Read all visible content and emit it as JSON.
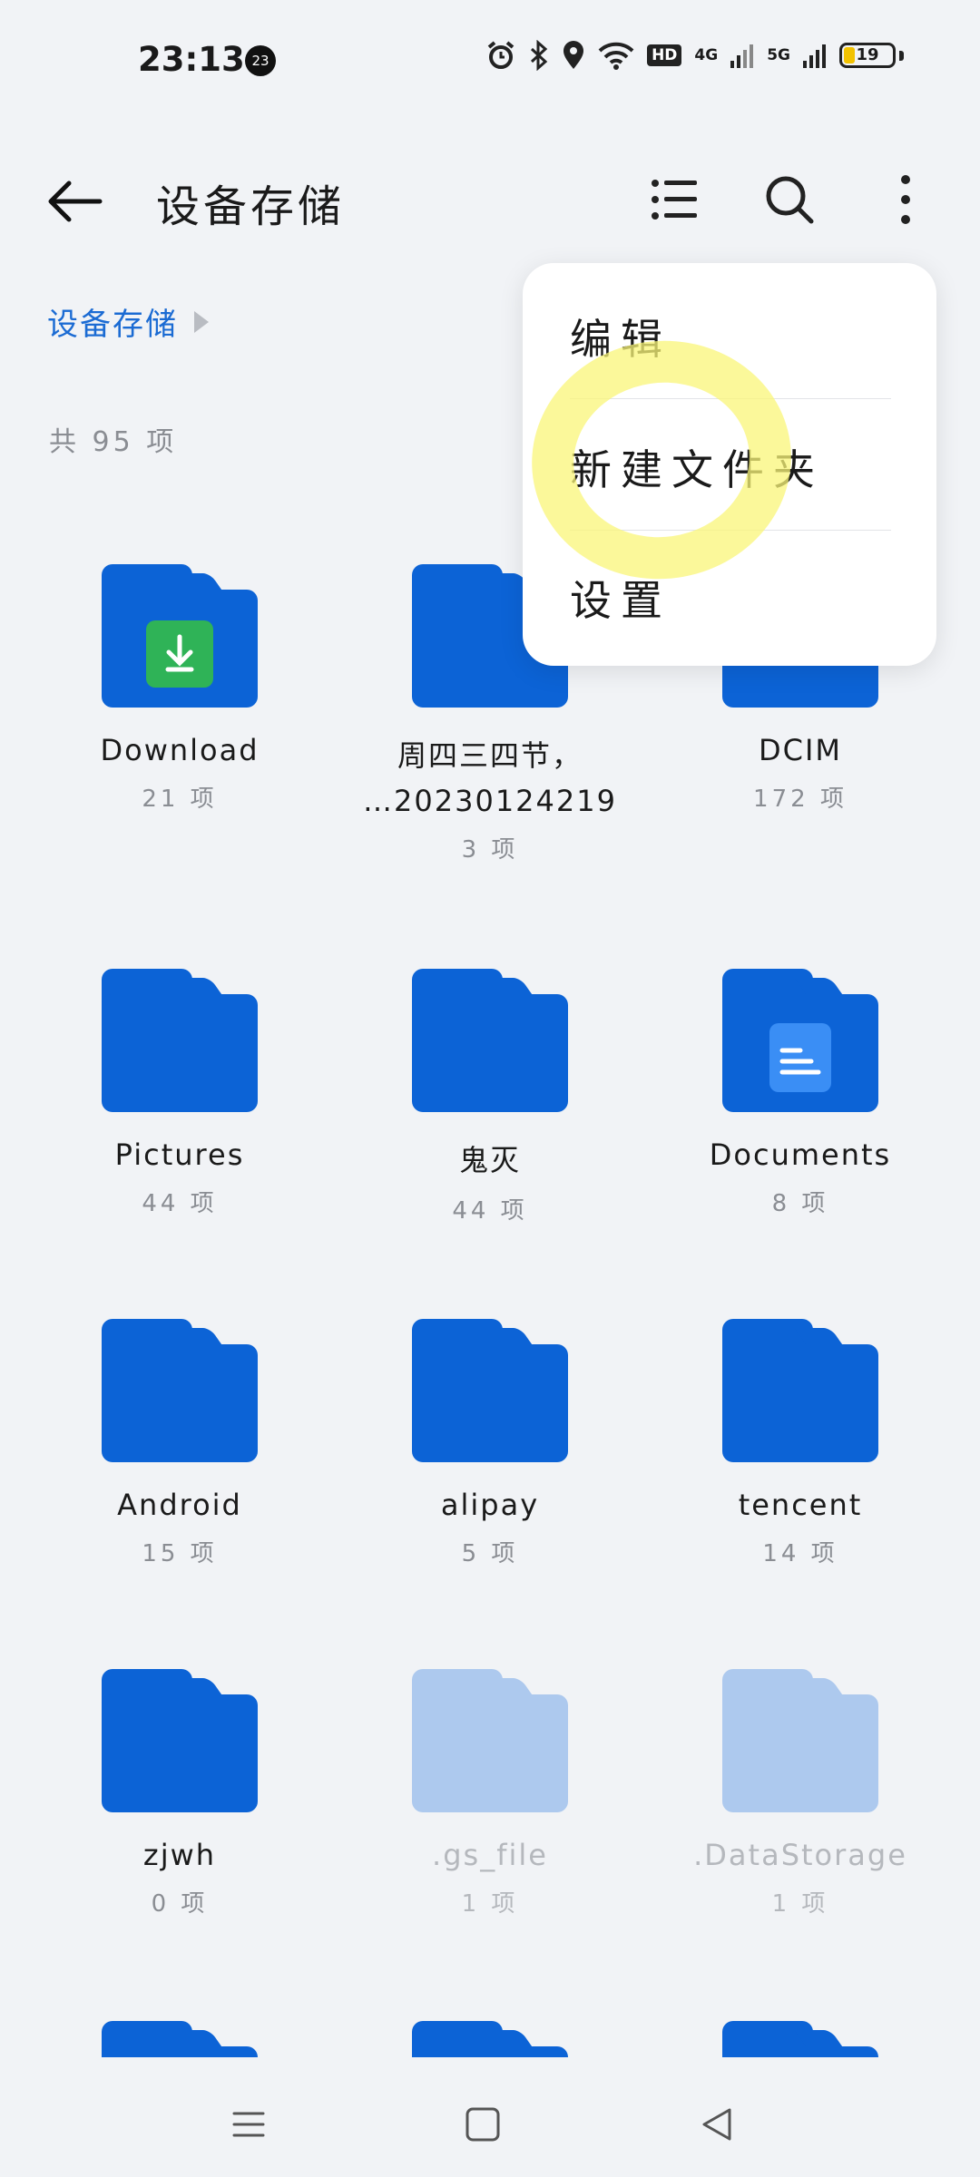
{
  "status_bar": {
    "time": "23:13",
    "notification_badge": "23",
    "network_hd": "HD",
    "network_4g": "4G",
    "network_5g": "5G",
    "battery_level": "19"
  },
  "header": {
    "title": "设备存储"
  },
  "breadcrumb": {
    "root": "设备存储"
  },
  "summary": {
    "count_text": "共 95 项"
  },
  "menu": {
    "items": [
      "编辑",
      "新建文件夹",
      "设置"
    ]
  },
  "folders": [
    {
      "name": "Download",
      "sub": "21 项",
      "badge": "download-icon"
    },
    {
      "name": "周四三四节，",
      "name2": "…20230124219",
      "sub": "3 项"
    },
    {
      "name": "DCIM",
      "sub": "172 项"
    },
    {
      "name": "Pictures",
      "sub": "44 项"
    },
    {
      "name": "鬼灭",
      "sub": "44 项"
    },
    {
      "name": "Documents",
      "sub": "8 项",
      "badge": "document-icon"
    },
    {
      "name": "Android",
      "sub": "15 项"
    },
    {
      "name": "alipay",
      "sub": "5 项"
    },
    {
      "name": "tencent",
      "sub": "14 项"
    },
    {
      "name": "zjwh",
      "sub": "0 项"
    },
    {
      "name": ".gs_file",
      "sub": "1 项",
      "hidden": true
    },
    {
      "name": ".DataStorage",
      "sub": "1 项",
      "hidden": true
    }
  ],
  "colors": {
    "folder": "#0c63d6",
    "folder_hidden": "#adc9ee",
    "accent": "#1b6bd3",
    "highlight": "#faf578"
  }
}
